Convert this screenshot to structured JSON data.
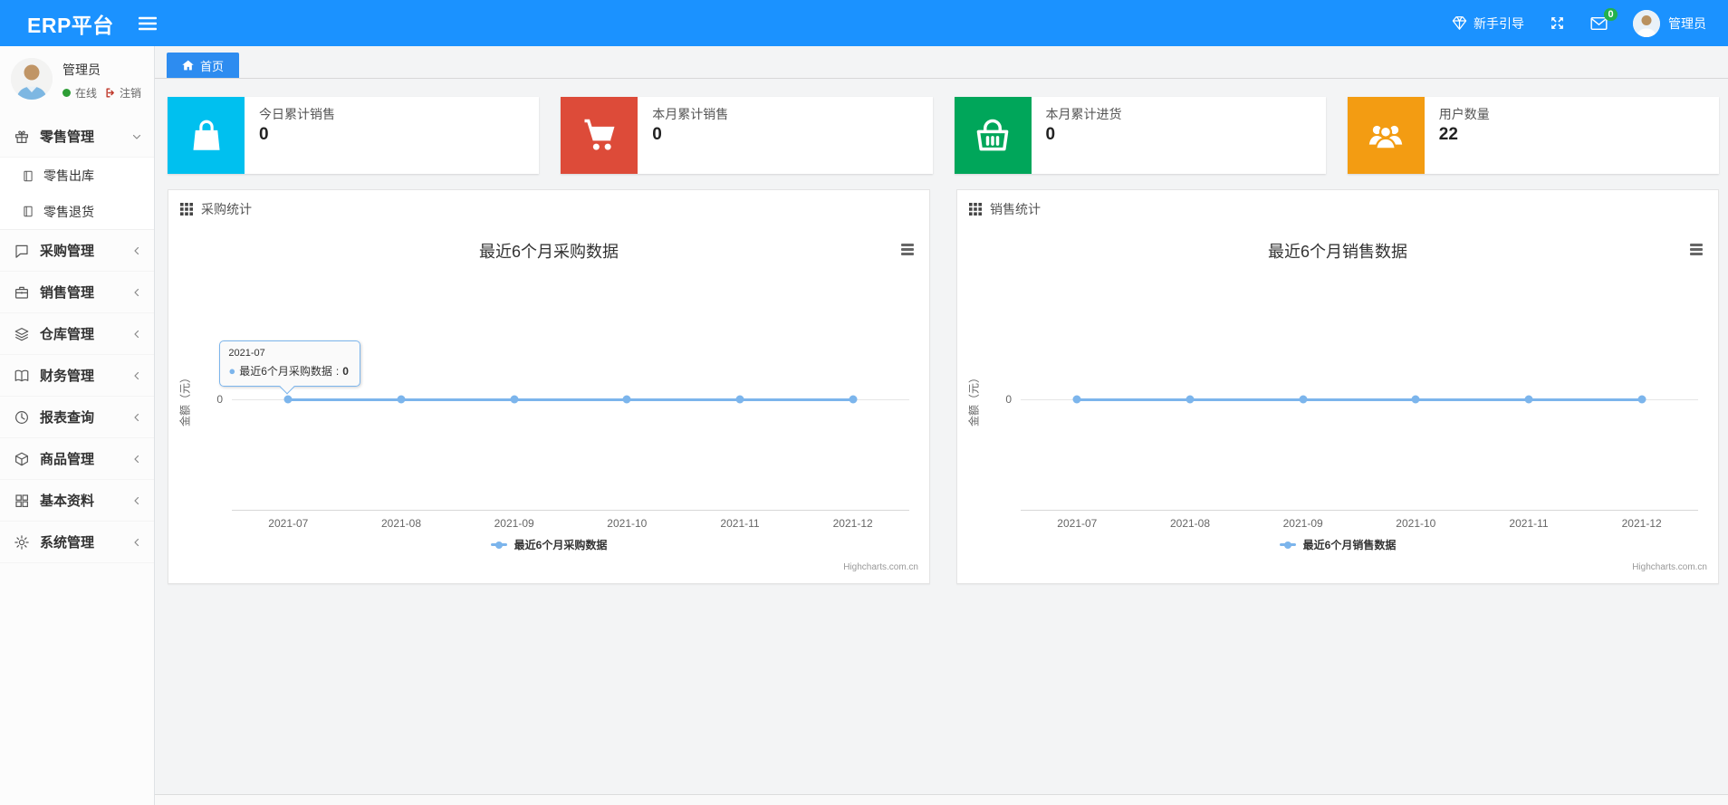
{
  "navbar": {
    "brand": "ERP平台",
    "guide_label": "新手引导",
    "mail_badge": "0",
    "username": "管理员",
    "accent_color": "#1b92ff"
  },
  "sidebar": {
    "user": {
      "name": "管理员",
      "status": "在线",
      "logout": "注销"
    },
    "menu": [
      {
        "label": "零售管理",
        "icon": "gift-icon",
        "state": "expanded",
        "children": [
          "零售出库",
          "零售退货"
        ]
      },
      {
        "label": "采购管理",
        "icon": "purchase-icon",
        "state": "collapsed"
      },
      {
        "label": "销售管理",
        "icon": "briefcase-icon",
        "state": "collapsed"
      },
      {
        "label": "仓库管理",
        "icon": "layers-icon",
        "state": "collapsed"
      },
      {
        "label": "财务管理",
        "icon": "book-icon",
        "state": "collapsed"
      },
      {
        "label": "报表查询",
        "icon": "clock-icon",
        "state": "collapsed"
      },
      {
        "label": "商品管理",
        "icon": "package-icon",
        "state": "collapsed"
      },
      {
        "label": "基本资料",
        "icon": "grid-icon",
        "state": "collapsed"
      },
      {
        "label": "系统管理",
        "icon": "gear-icon",
        "state": "collapsed"
      }
    ]
  },
  "tabs": [
    {
      "label": "首页",
      "active": true,
      "color": "#2d8cf0"
    }
  ],
  "stat_cards": [
    {
      "label": "今日累计销售",
      "value": "0",
      "icon": "shopping-bag-icon",
      "color": "#00c0ef"
    },
    {
      "label": "本月累计销售",
      "value": "0",
      "icon": "shopping-cart-icon",
      "color": "#dd4b39"
    },
    {
      "label": "本月累计进货",
      "value": "0",
      "icon": "shopping-basket-icon",
      "color": "#00a65a"
    },
    {
      "label": "用户数量",
      "value": "22",
      "icon": "users-icon",
      "color": "#f39c12"
    }
  ],
  "panels": [
    {
      "title": "采购统计"
    },
    {
      "title": "销售统计"
    }
  ],
  "chart_data": [
    {
      "type": "line",
      "title": "最近6个月采购数据",
      "categories": [
        "2021-07",
        "2021-08",
        "2021-09",
        "2021-10",
        "2021-11",
        "2021-12"
      ],
      "series": [
        {
          "name": "最近6个月采购数据",
          "values": [
            0,
            0,
            0,
            0,
            0,
            0
          ]
        }
      ],
      "xlabel": "",
      "ylabel": "金额（元）",
      "yticks": [
        "0"
      ],
      "ylim": [
        0,
        1
      ],
      "grid": true,
      "legend_position": "bottom",
      "line_color": "#7cb5ec",
      "credit": "Highcharts.com.cn",
      "tooltip": {
        "category": "2021-07",
        "series": "最近6个月采购数据",
        "value": "0"
      }
    },
    {
      "type": "line",
      "title": "最近6个月销售数据",
      "categories": [
        "2021-07",
        "2021-08",
        "2021-09",
        "2021-10",
        "2021-11",
        "2021-12"
      ],
      "series": [
        {
          "name": "最近6个月销售数据",
          "values": [
            0,
            0,
            0,
            0,
            0,
            0
          ]
        }
      ],
      "xlabel": "",
      "ylabel": "金额（元）",
      "yticks": [
        "0"
      ],
      "ylim": [
        0,
        1
      ],
      "grid": true,
      "legend_position": "bottom",
      "line_color": "#7cb5ec",
      "credit": "Highcharts.com.cn"
    }
  ]
}
